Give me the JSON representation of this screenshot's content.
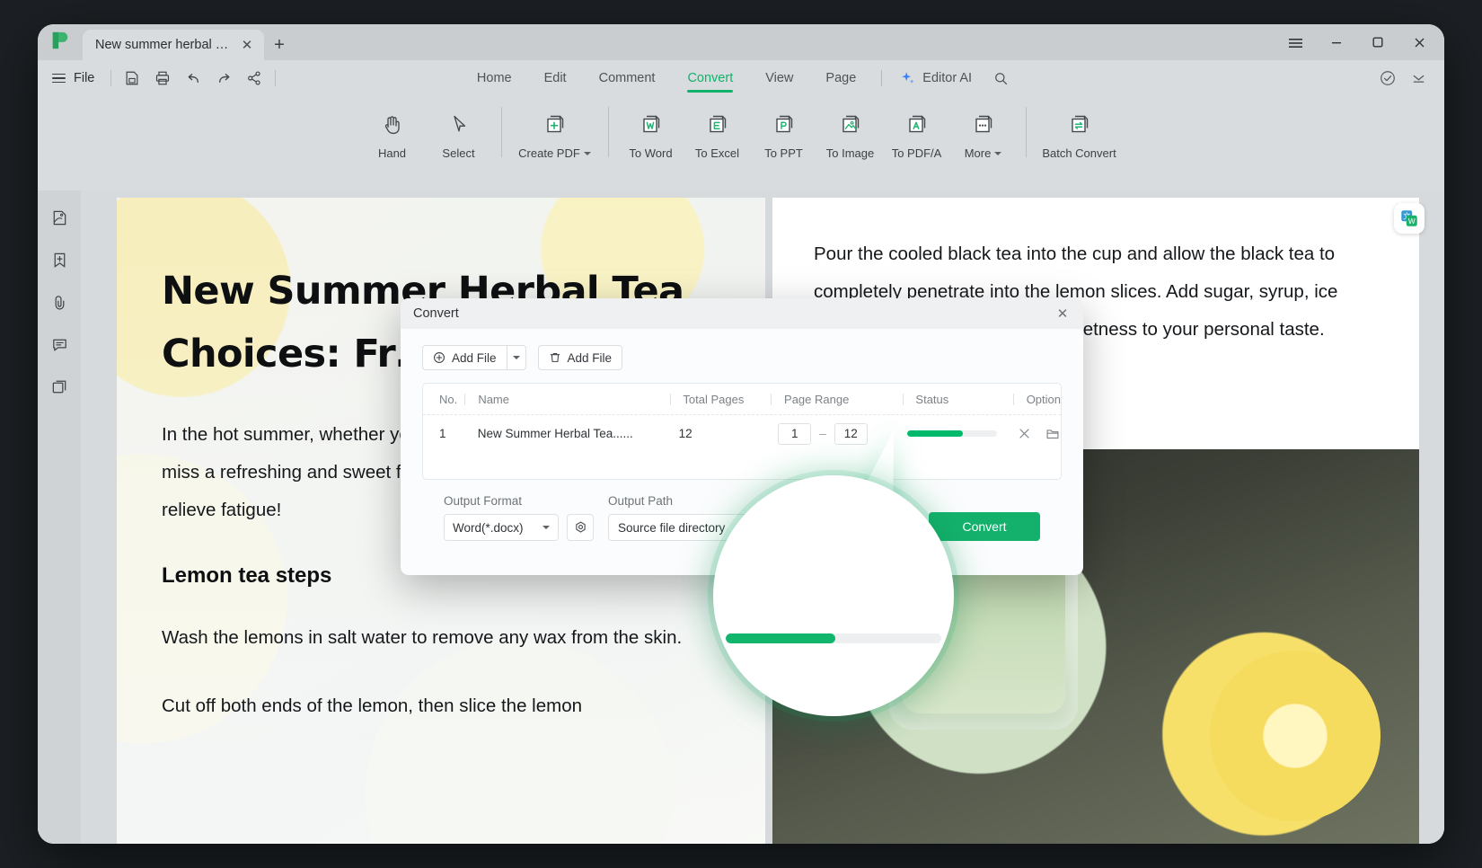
{
  "titlebar": {
    "tab_title": "New summer herbal te...",
    "new_tab_label": "+",
    "close_label": "✕",
    "menu_icon": "hamburger-icon",
    "minimize_label": "—",
    "maximize_label": "▢",
    "close_window_label": "✕"
  },
  "menubar": {
    "file_label": "File",
    "quick_icons": [
      "save-as-icon",
      "print-icon",
      "undo-icon",
      "redo-icon",
      "share-icon"
    ],
    "tabs": [
      {
        "label": "Home",
        "active": false
      },
      {
        "label": "Edit",
        "active": false
      },
      {
        "label": "Comment",
        "active": false
      },
      {
        "label": "Convert",
        "active": true
      },
      {
        "label": "View",
        "active": false
      },
      {
        "label": "Page",
        "active": false
      }
    ],
    "ai_label": "Editor AI",
    "search_icon": "search-icon",
    "right_icons": [
      "cloud-check-icon",
      "collapse-ribbon-icon"
    ]
  },
  "ribbon": {
    "items": [
      {
        "label": "Hand",
        "icon": "hand-icon",
        "caret": false
      },
      {
        "label": "Select",
        "icon": "cursor-icon",
        "caret": false
      },
      {
        "label": "Create PDF",
        "icon": "create-pdf-icon",
        "caret": true
      },
      {
        "label": "To Word",
        "icon": "to-word-icon",
        "caret": false
      },
      {
        "label": "To Excel",
        "icon": "to-excel-icon",
        "caret": false
      },
      {
        "label": "To PPT",
        "icon": "to-ppt-icon",
        "caret": false
      },
      {
        "label": "To Image",
        "icon": "to-image-icon",
        "caret": false
      },
      {
        "label": "To PDF/A",
        "icon": "to-pdfa-icon",
        "caret": false
      },
      {
        "label": "More",
        "icon": "more-icon",
        "caret": true
      },
      {
        "label": "Batch Convert",
        "icon": "batch-convert-icon",
        "caret": false
      }
    ]
  },
  "leftrail": {
    "items": [
      "thumbnails-icon",
      "bookmark-add-icon",
      "attachment-icon",
      "comment-icon",
      "layers-icon"
    ]
  },
  "document": {
    "left_page": {
      "title": "New Summer Herbal Tea Choices: Fr… Popular",
      "paragraph": "In the hot summer, whether you are outdoors or at home, you cannot miss a refreshing and sweet fruit drink that can relieve the heat and relieve fatigue!",
      "subheading": "Lemon tea steps",
      "steps": "Wash the lemons in salt water to remove any wax from the skin.",
      "steps2": "Cut off both ends of the lemon, then slice the lemon"
    },
    "right_page": {
      "paragraph": "Pour the cooled black tea into the cup and allow the black tea to completely penetrate into the lemon slices. Add sugar, syrup, ice cubes or honey to adjust the sweetness to your personal taste."
    },
    "translate_badge": "translate-icon"
  },
  "dialog": {
    "title": "Convert",
    "close_label": "✕",
    "add_file_label": "Add File",
    "clear_file_label": "Add File",
    "table": {
      "columns": [
        "No.",
        "Name",
        "Total Pages",
        "Page Range",
        "Status",
        "Option"
      ],
      "rows": [
        {
          "no": "1",
          "name": "New Summer Herbal Tea......",
          "total_pages": "12",
          "range_from": "1",
          "range_dash": "–",
          "range_to": "12",
          "progress_percent": 62,
          "option_icons": [
            "cancel-icon",
            "open-folder-icon"
          ]
        }
      ]
    },
    "output_format_label": "Output Format",
    "output_format_value": "Word(*.docx)",
    "settings_icon": "settings-gear-icon",
    "output_path_label": "Output Path",
    "output_path_value": "Source file directory",
    "convert_button": "Convert"
  },
  "magnifier": {
    "progress_percent": 51
  },
  "colors": {
    "accent": "#12b26b",
    "progress_fill": "#00b96b",
    "convert_button": "#14b16c",
    "titlebar": "#c9cdd0",
    "ribbon": "#d9dcde"
  }
}
